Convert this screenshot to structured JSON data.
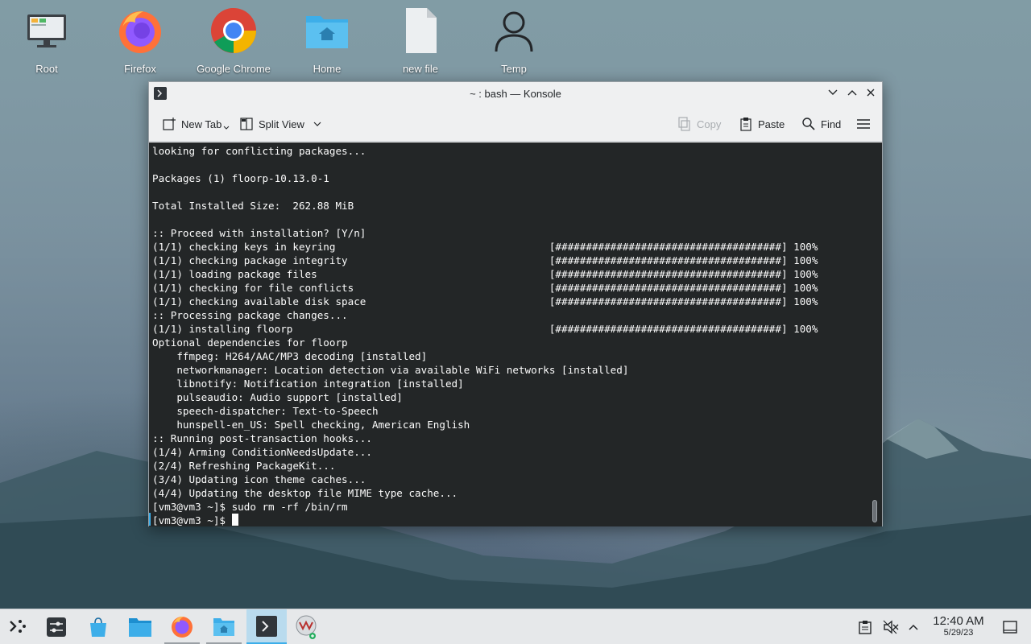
{
  "desktop": {
    "icons": [
      {
        "label": "Root"
      },
      {
        "label": "Firefox"
      },
      {
        "label": "Google Chrome"
      },
      {
        "label": "Home"
      },
      {
        "label": "new file"
      },
      {
        "label": "Temp"
      }
    ]
  },
  "window": {
    "title": "~ : bash — Konsole",
    "toolbar": {
      "new_tab": "New Tab",
      "split_view": "Split View",
      "copy": "Copy",
      "paste": "Paste",
      "find": "Find"
    },
    "terminal_lines": [
      "looking for conflicting packages...",
      "",
      "Packages (1) floorp-10.13.0-1",
      "",
      "Total Installed Size:  262.88 MiB",
      "",
      ":: Proceed with installation? [Y/n]",
      "(1/1) checking keys in keyring                                   [#####################################] 100%",
      "(1/1) checking package integrity                                 [#####################################] 100%",
      "(1/1) loading package files                                      [#####################################] 100%",
      "(1/1) checking for file conflicts                                [#####################################] 100%",
      "(1/1) checking available disk space                              [#####################################] 100%",
      ":: Processing package changes...",
      "(1/1) installing floorp                                          [#####################################] 100%",
      "Optional dependencies for floorp",
      "    ffmpeg: H264/AAC/MP3 decoding [installed]",
      "    networkmanager: Location detection via available WiFi networks [installed]",
      "    libnotify: Notification integration [installed]",
      "    pulseaudio: Audio support [installed]",
      "    speech-dispatcher: Text-to-Speech",
      "    hunspell-en_US: Spell checking, American English",
      ":: Running post-transaction hooks...",
      "(1/4) Arming ConditionNeedsUpdate...",
      "(2/4) Refreshing PackageKit...",
      "(3/4) Updating icon theme caches...",
      "(4/4) Updating the desktop file MIME type cache...",
      "[vm3@vm3 ~]$ sudo rm -rf /bin/rm"
    ],
    "prompt": "[vm3@vm3 ~]$ "
  },
  "taskbar": {
    "time": "12:40 AM",
    "date": "5/29/23"
  },
  "colors": {
    "accent": "#3daee9",
    "terminal_bg": "#232627",
    "terminal_fg": "#fcfcfc"
  }
}
